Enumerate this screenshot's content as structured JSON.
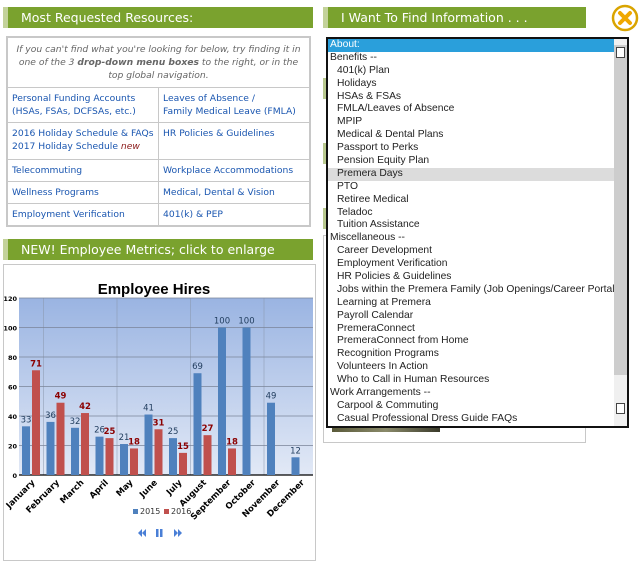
{
  "left": {
    "header": "Most Requested Resources:",
    "intro_pre": "If you can't find what you're looking for below, try finding it in one of the 3 ",
    "intro_bold": "drop-down menu boxes",
    "intro_post": " to the right, or in the top global navigation.",
    "links": [
      [
        "Personal Funding Accounts",
        "(HSAs, FSAs, DCFSAs, etc.)",
        "Leaves of Absence /",
        "Family Medical Leave (FMLA)"
      ],
      [
        "2016 Holiday Schedule & FAQs",
        "2017 Holiday Schedule",
        "HR Policies & Guidelines",
        ""
      ],
      [
        "Telecommuting",
        "",
        "Workplace Accommodations",
        ""
      ],
      [
        "Wellness Programs",
        "",
        "Medical, Dental & Vision",
        ""
      ],
      [
        "Employment Verification",
        "",
        "401(k) & PEP",
        ""
      ]
    ],
    "new_tag": "new",
    "metrics_header": "NEW! Employee Metrics; click to enlarge"
  },
  "right": {
    "header": "I Want To Find Information . . .",
    "close_icon": "close-x-circle-icon",
    "options": [
      {
        "label": "About:",
        "type": "group",
        "selected": true
      },
      {
        "label": "Benefits --",
        "type": "group"
      },
      {
        "label": "401(k) Plan",
        "type": "child"
      },
      {
        "label": "Holidays",
        "type": "child"
      },
      {
        "label": "HSAs & FSAs",
        "type": "child"
      },
      {
        "label": "FMLA/Leaves of Absence",
        "type": "child"
      },
      {
        "label": "MPIP",
        "type": "child"
      },
      {
        "label": "Medical & Dental Plans",
        "type": "child"
      },
      {
        "label": "Passport to Perks",
        "type": "child"
      },
      {
        "label": "Pension Equity Plan",
        "type": "child"
      },
      {
        "label": "Premera Days",
        "type": "child",
        "hover": true
      },
      {
        "label": "PTO",
        "type": "child"
      },
      {
        "label": "Retiree Medical",
        "type": "child"
      },
      {
        "label": "Teladoc",
        "type": "child"
      },
      {
        "label": "Tuition Assistance",
        "type": "child"
      },
      {
        "label": "Miscellaneous --",
        "type": "group"
      },
      {
        "label": "Career Development",
        "type": "child"
      },
      {
        "label": "Employment Verification",
        "type": "child"
      },
      {
        "label": "HR Policies & Guidelines",
        "type": "child"
      },
      {
        "label": "Jobs within the Premera Family (Job Openings/Career Portal)",
        "type": "child"
      },
      {
        "label": "Learning at Premera",
        "type": "child"
      },
      {
        "label": "Payroll Calendar",
        "type": "child"
      },
      {
        "label": "PremeraConnect",
        "type": "child"
      },
      {
        "label": "PremeraConnect from Home",
        "type": "child"
      },
      {
        "label": "Recognition Programs",
        "type": "child"
      },
      {
        "label": "Volunteers In Action",
        "type": "child"
      },
      {
        "label": "Who to Call in Human Resources",
        "type": "child"
      },
      {
        "label": "Work Arrangements --",
        "type": "group"
      },
      {
        "label": "Carpool & Commuting",
        "type": "child"
      },
      {
        "label": "Casual Professional Dress Guide FAQs",
        "type": "child"
      }
    ]
  },
  "chart_data": {
    "type": "bar",
    "title": "Employee Hires",
    "categories": [
      "January",
      "February",
      "March",
      "April",
      "May",
      "June",
      "July",
      "August",
      "September",
      "October",
      "November",
      "December"
    ],
    "series": [
      {
        "name": "2015",
        "color": "#4f81bd",
        "values": [
          33,
          36,
          32,
          26,
          21,
          41,
          25,
          69,
          100,
          100,
          49,
          12
        ]
      },
      {
        "name": "2016",
        "color": "#c0504d",
        "values": [
          71,
          49,
          42,
          25,
          18,
          31,
          15,
          27,
          18,
          null,
          null,
          null
        ]
      }
    ],
    "ylim": [
      0,
      120
    ],
    "yticks": [
      0,
      20,
      40,
      60,
      80,
      100,
      120
    ],
    "grid": true,
    "legend": "bottom"
  },
  "slideshow": {
    "prev_icon": "rewind-icon",
    "pause_icon": "pause-icon",
    "next_icon": "fast-forward-icon"
  }
}
